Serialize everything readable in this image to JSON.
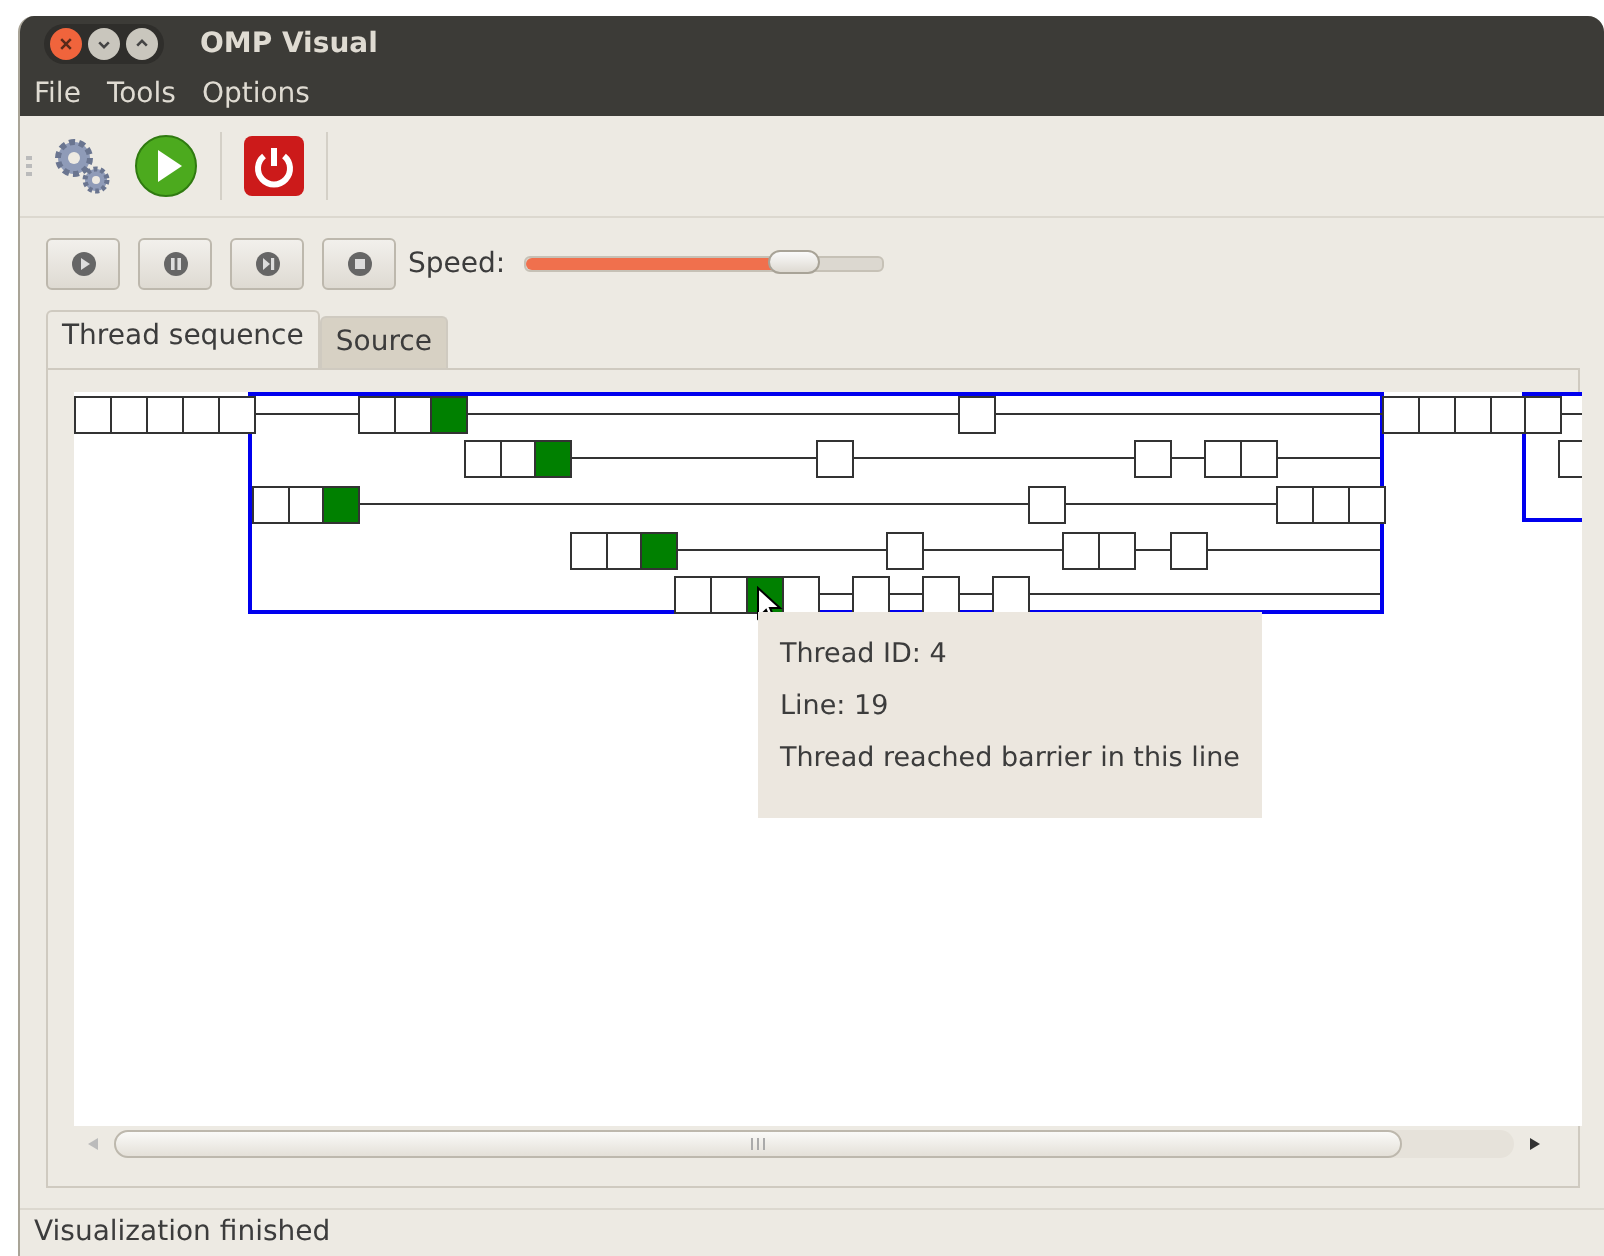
{
  "window": {
    "title": "OMP Visual"
  },
  "menu": [
    "File",
    "Tools",
    "Options"
  ],
  "playback": {
    "speed_label": "Speed:",
    "speed": {
      "level": 0.76
    }
  },
  "tabs": [
    {
      "label": "Thread sequence",
      "selected": true
    },
    {
      "label": "Source",
      "selected": false
    }
  ],
  "tooltip": [
    "Thread ID: 4",
    "Line: 19",
    "Thread reached barrier in this line"
  ],
  "status_bar": "Visualization finished"
}
